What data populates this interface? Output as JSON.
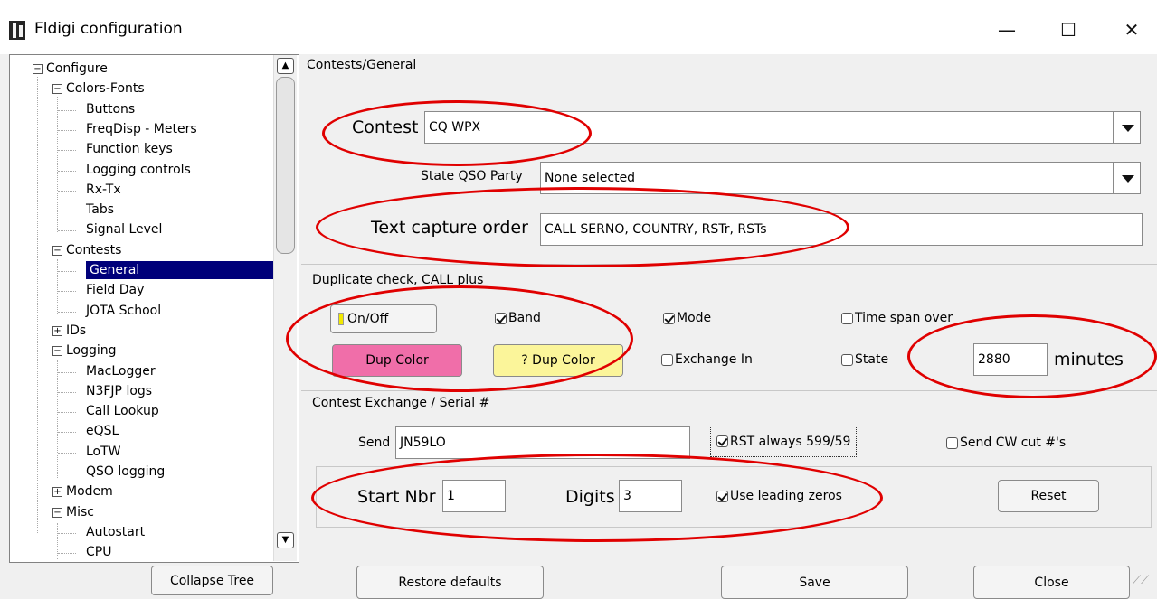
{
  "window": {
    "title": "Fldigi configuration",
    "controls": {
      "minimize": "—",
      "maximize": "☐",
      "close": "✕"
    }
  },
  "tree": {
    "items": [
      {
        "label": "Configure",
        "toggle": "−"
      },
      {
        "label": "Colors-Fonts",
        "toggle": "−"
      },
      {
        "label": "Buttons"
      },
      {
        "label": "FreqDisp - Meters"
      },
      {
        "label": "Function keys"
      },
      {
        "label": "Logging controls"
      },
      {
        "label": "Rx-Tx"
      },
      {
        "label": "Tabs"
      },
      {
        "label": "Signal Level"
      },
      {
        "label": "Contests",
        "toggle": "−"
      },
      {
        "label": "General",
        "selected": true
      },
      {
        "label": "Field Day"
      },
      {
        "label": "JOTA School"
      },
      {
        "label": "IDs",
        "toggle": "+"
      },
      {
        "label": "Logging",
        "toggle": "−"
      },
      {
        "label": "MacLogger"
      },
      {
        "label": "N3FJP logs"
      },
      {
        "label": "Call Lookup"
      },
      {
        "label": "eQSL"
      },
      {
        "label": "LoTW"
      },
      {
        "label": "QSO logging"
      },
      {
        "label": "Modem",
        "toggle": "+"
      },
      {
        "label": "Misc",
        "toggle": "−"
      },
      {
        "label": "Autostart"
      },
      {
        "label": "CPU"
      }
    ]
  },
  "panel": {
    "heading": "Contests/General",
    "contest": {
      "label": "Contest",
      "value": "CQ WPX"
    },
    "state_qso_party": {
      "label": "State QSO Party",
      "value": "None selected"
    },
    "text_capture": {
      "label": "Text capture order",
      "value": "CALL SERNO, COUNTRY, RSTr, RSTs"
    },
    "dup": {
      "heading": "Duplicate check, CALL plus",
      "onoff_label": "On/Off",
      "band": {
        "label": "Band",
        "checked": true
      },
      "mode": {
        "label": "Mode",
        "checked": true
      },
      "timespan": {
        "label": "Time span over",
        "checked": false
      },
      "dup_color_label": "Dup Color",
      "q_dup_color_label": "? Dup Color",
      "exchange_in": {
        "label": "Exchange In",
        "checked": false
      },
      "state": {
        "label": "State",
        "checked": false
      },
      "minutes_value": "2880",
      "minutes_label": "minutes",
      "dup_color": "#f06ea9",
      "q_dup_color": "#fbf59a"
    },
    "exchange": {
      "heading": "Contest Exchange / Serial #",
      "send_label": "Send",
      "send_value": "JN59LO",
      "rst_always": {
        "label": "RST always 599/59",
        "checked": true
      },
      "send_cw_cut": {
        "label": "Send CW cut #'s",
        "checked": false
      },
      "start_label": "Start Nbr",
      "start_value": "1",
      "digits_label": "Digits",
      "digits_value": "3",
      "leading_zeros": {
        "label": "Use leading zeros",
        "checked": true
      },
      "reset_label": "Reset"
    }
  },
  "footer": {
    "collapse_label": "Collapse Tree",
    "restore_label": "Restore defaults",
    "save_label": "Save",
    "close_label": "Close"
  },
  "colors": {
    "annotation": "#e00000",
    "selection": "#00007a"
  }
}
